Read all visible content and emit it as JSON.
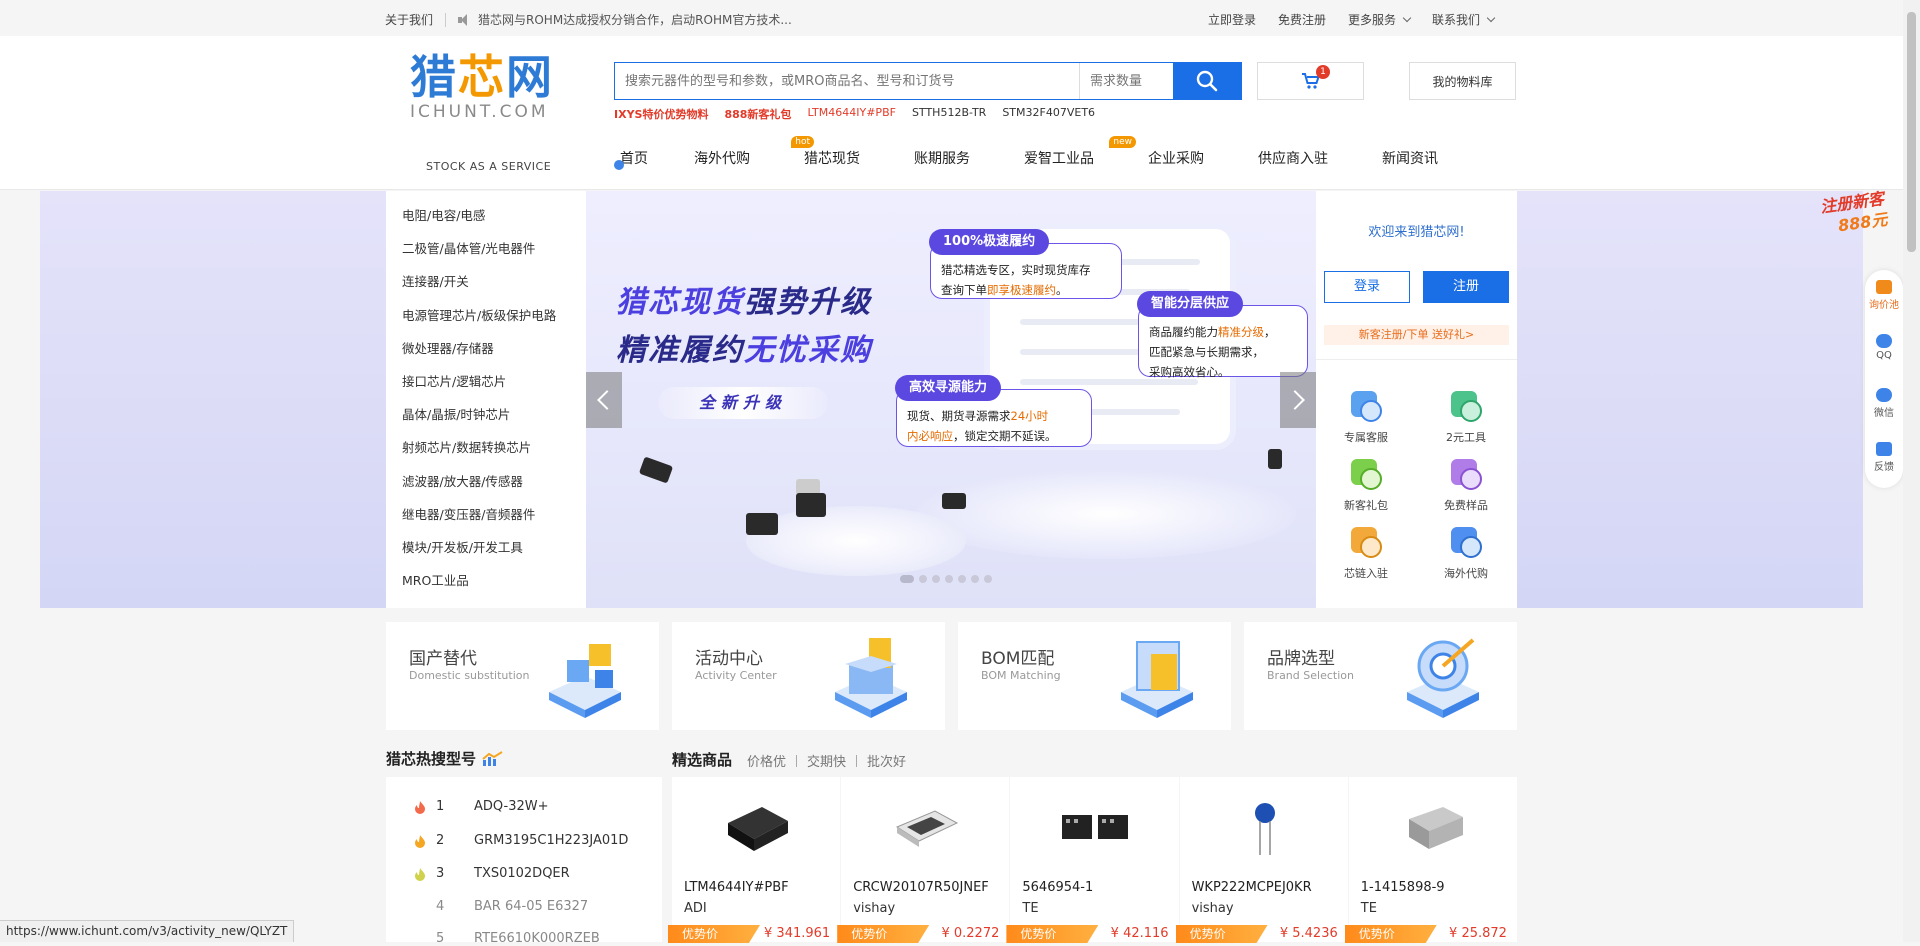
{
  "topbar": {
    "about": "关于我们",
    "notice": "猎芯网与ROHM达成授权分销合作，启动ROHM官方技术...",
    "login": "立即登录",
    "register": "免费注册",
    "more_services": "更多服务",
    "contact": "联系我们"
  },
  "header": {
    "logo_cn_a": "猎",
    "logo_cn_b": "芯",
    "logo_cn_c": "网",
    "logo_en": "ICHUNT.COM",
    "slogan": "STOCK AS A SERVICE",
    "search_placeholder": "搜索元器件的型号和参数，或MRO商品名、型号和订货号",
    "qty_placeholder": "需求数量",
    "cart_count": "1",
    "bom_label": "我的物料库",
    "hotwords": [
      "IXYS特价优势物料",
      "888新客礼包",
      "LTM4644IY#PBF",
      "STTH512B-TR",
      "STM32F407VET6"
    ]
  },
  "nav": {
    "items": [
      "首页",
      "海外代购",
      "猎芯现货",
      "账期服务",
      "爱智工业品",
      "企业采购",
      "供应商入驻",
      "新闻资讯"
    ],
    "hot_tag": "hot",
    "new_tag": "new"
  },
  "categories": [
    "电阻/电容/电感",
    "二极管/晶体管/光电器件",
    "连接器/开关",
    "电源管理芯片/板级保护电路",
    "微处理器/存储器",
    "接口芯片/逻辑芯片",
    "晶体/晶振/时钟芯片",
    "射频芯片/数据转换芯片",
    "滤波器/放大器/传感器",
    "继电器/变压器/音频器件",
    "模块/开发板/开发工具",
    "MRO工业品"
  ],
  "banner": {
    "line1_a": "猎芯现货",
    "line1_b": "强势升级",
    "line2_a": "精准履约",
    "line2_b": "无忧采购",
    "upgrade": "全新升级",
    "card1": {
      "title": "100%极速履约",
      "l1": "猎芯精选专区，实时现货库存",
      "l2a": "查询下单",
      "l2b": "即享极速履约",
      "l2c": "。"
    },
    "card2": {
      "title": "智能分层供应",
      "l1a": "商品履约能力",
      "l1b": "精准分级",
      "l1c": "，",
      "l2": "匹配紧急与长期需求，",
      "l3": "采购高效省心。"
    },
    "card3": {
      "title": "高效寻源能力",
      "l1a": "现货、期货寻源需求",
      "l1b": "24小时",
      "l2a": "内必响应",
      "l2b": "，锁定交期不延误。"
    }
  },
  "sidepanel": {
    "welcome": "欢迎来到猎芯网!",
    "login": "登录",
    "register": "注册",
    "promo": "新客注册/下单 送好礼>",
    "services": [
      "专属客服",
      "2元工具",
      "新客礼包",
      "免费样品",
      "芯链入驻",
      "海外代购"
    ]
  },
  "float": {
    "reg_line1": "注册新客",
    "reg_line2": "888元"
  },
  "rightbar": [
    "询价池",
    "QQ",
    "微信",
    "反馈"
  ],
  "tiles": [
    {
      "zh": "国产替代",
      "en": "Domestic substitution"
    },
    {
      "zh": "活动中心",
      "en": "Activity Center"
    },
    {
      "zh": "BOM匹配",
      "en": "BOM Matching"
    },
    {
      "zh": "品牌选型",
      "en": "Brand Selection"
    }
  ],
  "hot": {
    "title": "猎芯热搜型号",
    "rows": [
      {
        "n": "1",
        "pn": "ADQ-32W+"
      },
      {
        "n": "2",
        "pn": "GRM3195C1H223JA01D"
      },
      {
        "n": "3",
        "pn": "TXS0102DQER"
      },
      {
        "n": "4",
        "pn": "BAR 64-05 E6327"
      },
      {
        "n": "5",
        "pn": "RTE6610K000RZEB"
      }
    ]
  },
  "picks": {
    "title": "精选商品",
    "tabs": [
      "价格优",
      "交期快",
      "批次好"
    ],
    "tag": "优势价",
    "items": [
      {
        "pn": "LTM4644IY#PBF",
        "brand": "ADI",
        "price": "¥ 341.961"
      },
      {
        "pn": "CRCW20107R50JNEF",
        "brand": "vishay",
        "price": "¥ 0.2272"
      },
      {
        "pn": "5646954-1",
        "brand": "TE",
        "price": "¥ 42.116"
      },
      {
        "pn": "WKP222MCPEJ0KR",
        "brand": "vishay",
        "price": "¥ 5.4236"
      },
      {
        "pn": "1-1415898-9",
        "brand": "TE",
        "price": "¥ 25.872"
      }
    ]
  },
  "status_url": "https://www.ichunt.com/v3/activity_new/QLYZT"
}
